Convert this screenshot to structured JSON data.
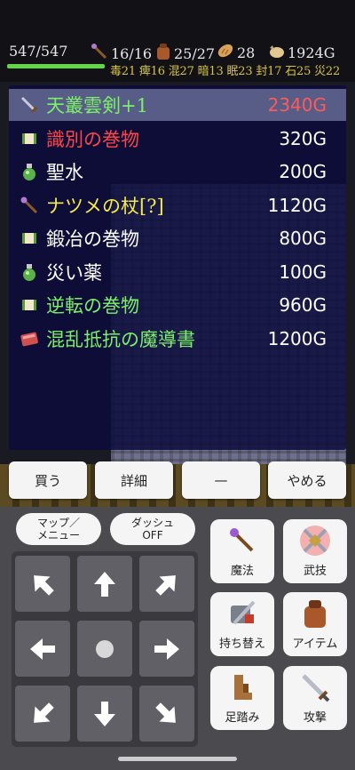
{
  "status": {
    "hp": "547/547",
    "hp_ratio": 1.0,
    "stats": [
      {
        "icon": "staff-icon",
        "value": "16/16"
      },
      {
        "icon": "bag-icon",
        "value": "25/27"
      },
      {
        "icon": "bread-icon",
        "value": "28"
      },
      {
        "icon": "money-bag-icon",
        "value": "1924G"
      }
    ],
    "effects": "毒21 痺16 混27 暗13 眠23 封17 石25 災22"
  },
  "shop": {
    "items": [
      {
        "icon": "sword-icon",
        "name": "天叢雲剣+1",
        "price": "2340G",
        "name_color": "#7cf06a",
        "price_color": "#ff5a5a",
        "selected": true
      },
      {
        "icon": "scroll-icon",
        "name": "識別の巻物",
        "price": "320G",
        "name_color": "#ff4646",
        "price_color": "#ffffff"
      },
      {
        "icon": "potion-icon",
        "name": "聖水",
        "price": "200G",
        "name_color": "#ffffff",
        "price_color": "#ffffff"
      },
      {
        "icon": "staff-icon",
        "name": "ナツメの杖[?]",
        "price": "1120G",
        "name_color": "#f5ea4a",
        "price_color": "#ffffff"
      },
      {
        "icon": "scroll-icon",
        "name": "鍛冶の巻物",
        "price": "800G",
        "name_color": "#ffffff",
        "price_color": "#ffffff"
      },
      {
        "icon": "potion-icon",
        "name": "災い薬",
        "price": "100G",
        "name_color": "#ffffff",
        "price_color": "#ffffff"
      },
      {
        "icon": "scroll-icon",
        "name": "逆転の巻物",
        "price": "960G",
        "name_color": "#7cf06a",
        "price_color": "#ffffff"
      },
      {
        "icon": "book-icon",
        "name": "混乱抵抗の魔導書",
        "price": "1200G",
        "name_color": "#7cf06a",
        "price_color": "#ffffff"
      }
    ],
    "actions": {
      "buy": "買う",
      "detail": "詳細",
      "none": "—",
      "quit": "やめる"
    }
  },
  "controls": {
    "map_menu": [
      "マップ／",
      "メニュー"
    ],
    "dash": [
      "ダッシュ",
      "OFF"
    ],
    "skills": {
      "magic": "魔法",
      "martial": "武技",
      "switch": "持ち替え",
      "item": "アイテム",
      "step": "足踏み",
      "attack": "攻撃"
    }
  },
  "colors": {
    "hp_bar": "#63d646",
    "effects": "#d7c24a",
    "panel": "#0c0c3c"
  }
}
